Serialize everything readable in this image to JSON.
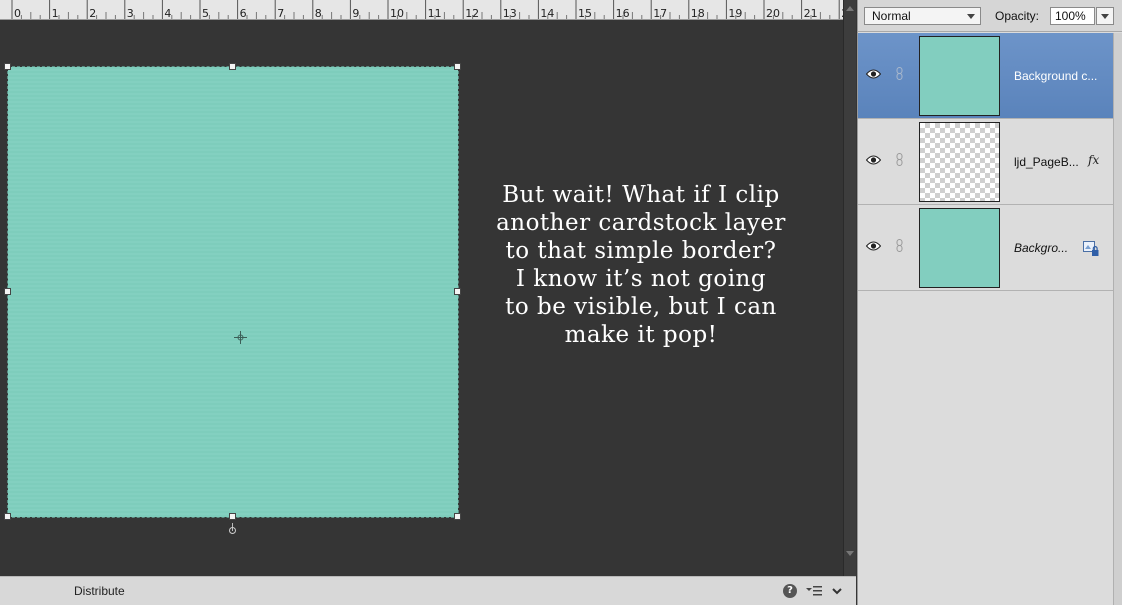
{
  "ruler": {
    "labels": [
      "0",
      "1",
      "2",
      "3",
      "4",
      "5",
      "6",
      "7",
      "8",
      "9",
      "10",
      "11",
      "12",
      "13",
      "14",
      "15",
      "16",
      "17",
      "18",
      "19",
      "20",
      "21",
      "2"
    ]
  },
  "canvas": {
    "layer_color": "#7ecdbc",
    "annotation": "But wait! What if I clip\nanother cardstock layer\nto that simple border?\nI know it’s not going\nto be visible, but I can\nmake it pop!"
  },
  "bottom_bar": {
    "distribute_label": "Distribute",
    "help_icon": "question-icon",
    "options_icon": "panel-options-icon",
    "collapse_icon": "chevron-down-icon"
  },
  "layers_panel": {
    "blend_mode": "Normal",
    "opacity_label": "Opacity:",
    "opacity_value": "100%",
    "layers": [
      {
        "name": "Background c...",
        "thumb": "solid",
        "selected": true,
        "fx": "",
        "italic": false,
        "locked": false
      },
      {
        "name": "ljd_PageB...",
        "thumb": "transparent",
        "selected": false,
        "fx": "fx",
        "italic": false,
        "locked": false
      },
      {
        "name": "Backgro...",
        "thumb": "solid",
        "selected": false,
        "fx": "",
        "italic": true,
        "locked": true
      }
    ]
  },
  "colors": {
    "canvas_bg": "#353535",
    "selection": "#5f88c0",
    "teal": "#82cebf"
  }
}
